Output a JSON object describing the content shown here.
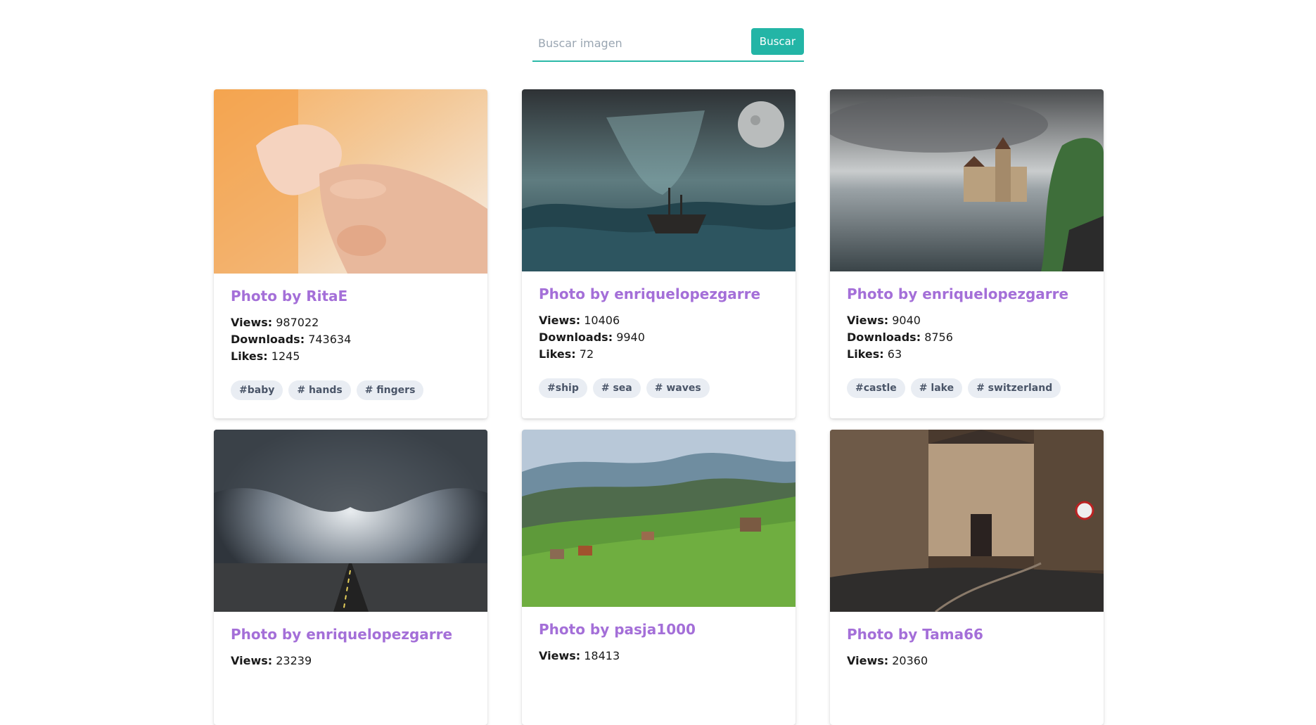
{
  "search": {
    "placeholder": "Buscar imagen",
    "button_label": "Buscar",
    "accent_color": "#23b5a6"
  },
  "cards": [
    {
      "title": "Photo by RitaE",
      "views_label": "Views:",
      "views": "987022",
      "downloads_label": "Downloads:",
      "downloads": "743634",
      "likes_label": "Likes:",
      "likes": "1245",
      "tags": [
        "#baby",
        "# hands",
        "# fingers"
      ]
    },
    {
      "title": "Photo by enriquelopezgarre",
      "views_label": "Views:",
      "views": "10406",
      "downloads_label": "Downloads:",
      "downloads": "9940",
      "likes_label": "Likes:",
      "likes": "72",
      "tags": [
        "#ship",
        "# sea",
        "# waves"
      ]
    },
    {
      "title": "Photo by enriquelopezgarre",
      "views_label": "Views:",
      "views": "9040",
      "downloads_label": "Downloads:",
      "downloads": "8756",
      "likes_label": "Likes:",
      "likes": "63",
      "tags": [
        "#castle",
        "# lake",
        "# switzerland"
      ]
    },
    {
      "title": "Photo by enriquelopezgarre",
      "views_label": "Views:",
      "views": "23239"
    },
    {
      "title": "Photo by pasja1000",
      "views_label": "Views:",
      "views": "18413"
    },
    {
      "title": "Photo by Tama66",
      "views_label": "Views:",
      "views": "20360"
    }
  ],
  "colors": {
    "title": "#a46fd8",
    "tag_bg": "#e9edf3",
    "tag_text": "#4a5568"
  }
}
